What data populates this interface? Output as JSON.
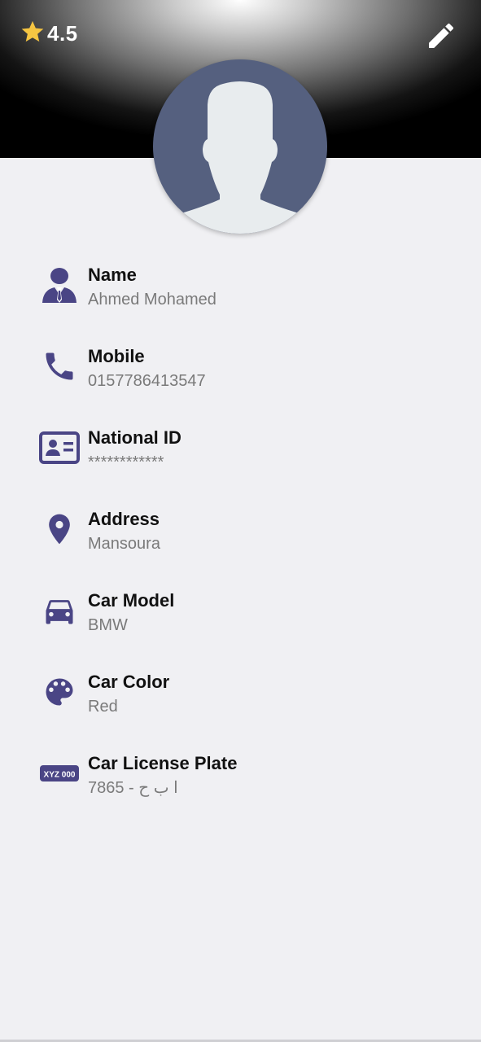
{
  "header": {
    "rating": "4.5",
    "star_color": "#f5c542",
    "edit_icon": "pencil-icon"
  },
  "avatar": {
    "icon": "person-silhouette-icon",
    "background": "#55607f"
  },
  "accent_color": "#4a4585",
  "fields": [
    {
      "label": "Name",
      "value": "Ahmed Mohamed",
      "icon": "businessman-icon"
    },
    {
      "label": "Mobile",
      "value": "0157786413547",
      "icon": "phone-icon"
    },
    {
      "label": "National ID",
      "value": "************",
      "icon": "id-card-icon"
    },
    {
      "label": "Address",
      "value": "Mansoura",
      "icon": "location-pin-icon"
    },
    {
      "label": "Car Model",
      "value": "BMW",
      "icon": "car-icon"
    },
    {
      "label": "Car Color",
      "value": "Red",
      "icon": "palette-icon"
    },
    {
      "label": "Car License Plate",
      "value": "ا ب ح - 7865",
      "icon": "license-plate-icon",
      "plate_text": "XYZ 000"
    }
  ]
}
